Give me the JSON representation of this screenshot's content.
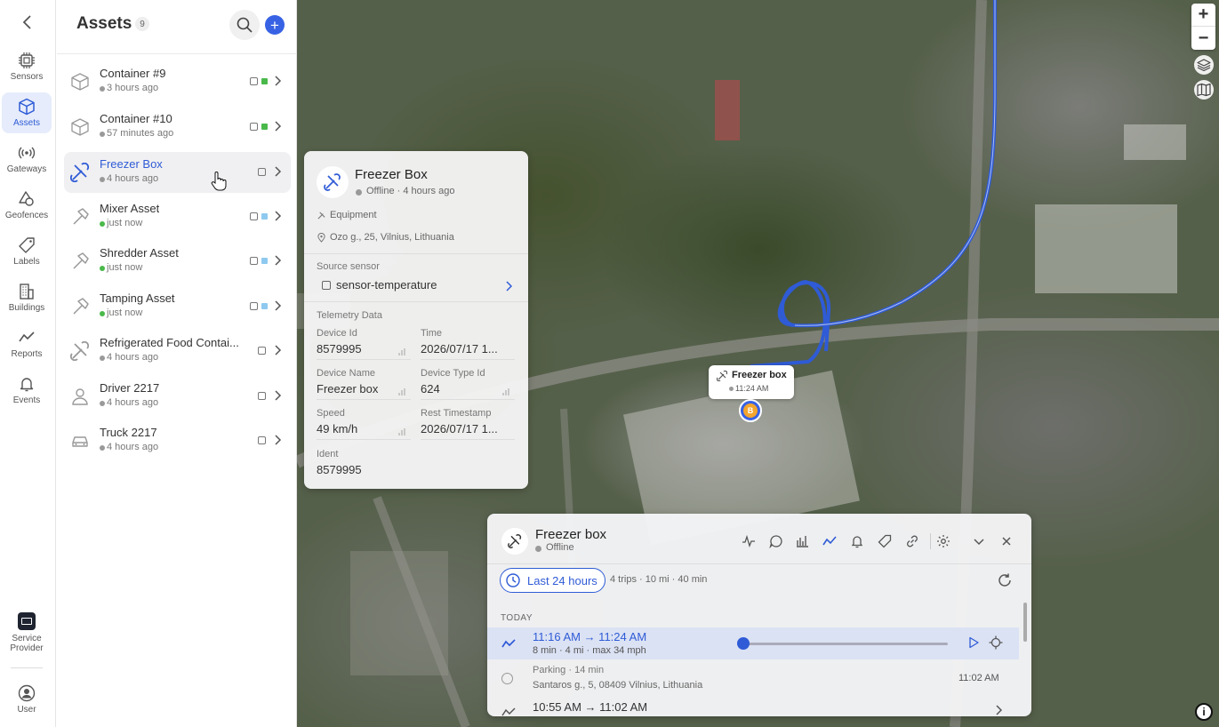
{
  "nav": {
    "items": [
      {
        "label": "Sensors",
        "icon": "chip-icon"
      },
      {
        "label": "Assets",
        "icon": "cube-icon",
        "active": true
      },
      {
        "label": "Gateways",
        "icon": "broadcast-icon"
      },
      {
        "label": "Geofences",
        "icon": "geofence-icon"
      },
      {
        "label": "Labels",
        "icon": "tag-icon"
      },
      {
        "label": "Buildings",
        "icon": "building-icon"
      },
      {
        "label": "Reports",
        "icon": "chart-line-icon"
      },
      {
        "label": "Events",
        "icon": "bell-icon"
      }
    ],
    "service_provider": "Service\nProvider",
    "service_provider_l1": "Service",
    "service_provider_l2": "Provider",
    "user": "User"
  },
  "assets_panel": {
    "title": "Assets",
    "count": "9",
    "items": [
      {
        "name": "Container #9",
        "time": "3 hours ago",
        "online": false,
        "status_color": "#49b94a",
        "icon": "cube-icon"
      },
      {
        "name": "Container #10",
        "time": "57 minutes ago",
        "online": false,
        "status_color": "#49b94a",
        "icon": "cube-icon"
      },
      {
        "name": "Freezer Box",
        "time": "4 hours ago",
        "online": false,
        "status_color": "",
        "icon": "tools-icon",
        "selected": true
      },
      {
        "name": "Mixer Asset",
        "time": "just now",
        "online": true,
        "status_color": "#8ec9f0",
        "icon": "hammer-icon"
      },
      {
        "name": "Shredder Asset",
        "time": "just now",
        "online": true,
        "status_color": "#8ec9f0",
        "icon": "hammer-icon"
      },
      {
        "name": "Tamping Asset",
        "time": "just now",
        "online": true,
        "status_color": "#8ec9f0",
        "icon": "hammer-icon"
      },
      {
        "name": "Refrigerated Food Contai...",
        "time": "4 hours ago",
        "online": false,
        "status_color": "",
        "icon": "tools-icon"
      },
      {
        "name": "Driver 2217",
        "time": "4 hours ago",
        "online": false,
        "status_color": "",
        "icon": "person-icon"
      },
      {
        "name": "Truck 2217",
        "time": "4 hours ago",
        "online": false,
        "status_color": "",
        "icon": "car-icon"
      }
    ]
  },
  "detail": {
    "title": "Freezer Box",
    "status": "Offline · 4 hours ago",
    "category": "Equipment",
    "address": "Ozo g., 25, Vilnius, Lithuania",
    "source_sensor_label": "Source sensor",
    "source_sensor": "sensor-temperature",
    "telemetry_label": "Telemetry Data",
    "fields": [
      {
        "label": "Device Id",
        "value": "8579995"
      },
      {
        "label": "Time",
        "value": "2026/07/17 1..."
      },
      {
        "label": "Device Name",
        "value": "Freezer box"
      },
      {
        "label": "Device Type Id",
        "value": "624"
      },
      {
        "label": "Speed",
        "value": "49 km/h"
      },
      {
        "label": "Rest Timestamp",
        "value": "2026/07/17 1..."
      },
      {
        "label": "Ident",
        "value": "8579995"
      }
    ]
  },
  "map": {
    "marker_name": "Freezer box",
    "marker_time": "11:24 AM",
    "marker_letter": "B",
    "zoom_in": "+",
    "zoom_out": "−",
    "info": "i",
    "route_color": "#2f5bd6"
  },
  "card": {
    "title": "Freezer box",
    "status": "Offline",
    "range": "Last 24 hours",
    "summary": "4 trips · 10 mi · 40 min",
    "today": "TODAY",
    "trip1": {
      "title": "11:16 AM → 11:24 AM",
      "sub": "8 min · 4 mi · max 34 mph"
    },
    "parking": {
      "title": "Parking · 14 min",
      "address": "Santaros g., 5, 08409 Vilnius, Lithuania",
      "time": "11:02 AM"
    },
    "trip2": {
      "title": "10:55 AM → 11:02 AM"
    }
  }
}
